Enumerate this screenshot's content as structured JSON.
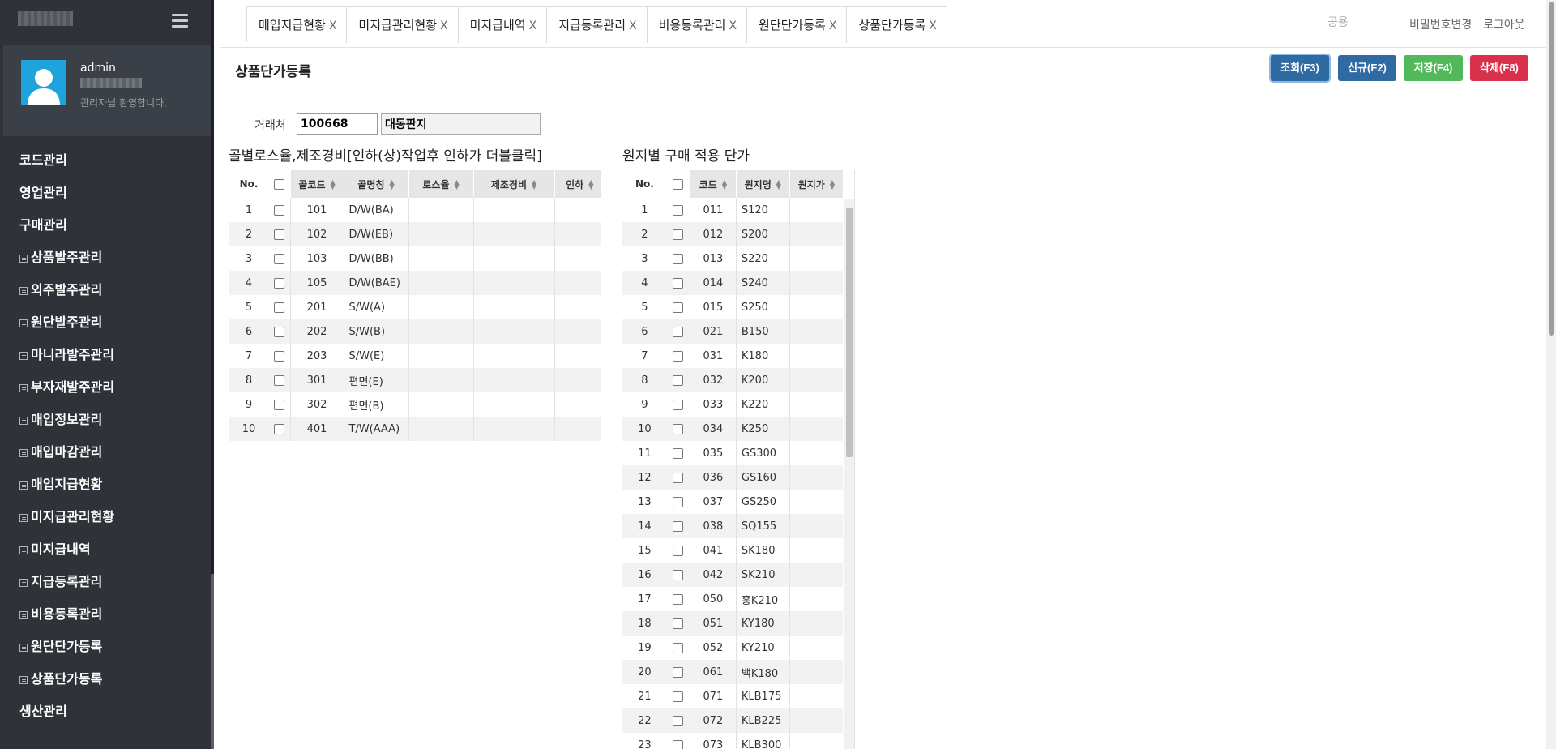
{
  "sidebar": {
    "user_name": "admin",
    "welcome": "관리자님 환영합니다.",
    "menu": [
      {
        "label": "코드관리",
        "sub": false
      },
      {
        "label": "영업관리",
        "sub": false
      },
      {
        "label": "구매관리",
        "sub": false
      },
      {
        "label": "상품발주관리",
        "sub": true
      },
      {
        "label": "외주발주관리",
        "sub": true
      },
      {
        "label": "원단발주관리",
        "sub": true
      },
      {
        "label": "마니라발주관리",
        "sub": true
      },
      {
        "label": "부자재발주관리",
        "sub": true
      },
      {
        "label": "매입정보관리",
        "sub": true
      },
      {
        "label": "매입마감관리",
        "sub": true
      },
      {
        "label": "매입지급현황",
        "sub": true
      },
      {
        "label": "미지급관리현황",
        "sub": true
      },
      {
        "label": "미지급내역",
        "sub": true
      },
      {
        "label": "지급등록관리",
        "sub": true
      },
      {
        "label": "비용등록관리",
        "sub": true
      },
      {
        "label": "원단단가등록",
        "sub": true
      },
      {
        "label": "상품단가등록",
        "sub": true
      },
      {
        "label": "생산관리",
        "sub": false
      }
    ]
  },
  "tabs": [
    {
      "label": "매입지급현황",
      "close": "X"
    },
    {
      "label": "미지급관리현황",
      "close": "X"
    },
    {
      "label": "미지급내역",
      "close": "X"
    },
    {
      "label": "지급등록관리",
      "close": "X"
    },
    {
      "label": "비용등록관리",
      "close": "X"
    },
    {
      "label": "원단단가등록",
      "close": "X"
    },
    {
      "label": "상품단가등록",
      "close": "X"
    }
  ],
  "header": {
    "search_placeholder": "공용",
    "change_password": "비밀번호변경",
    "logout": "로그아웃"
  },
  "page": {
    "title": "상품단가등록",
    "buttons": {
      "search": "조회(F3)",
      "new": "신규(F2)",
      "save": "저장(F4)",
      "delete": "삭제(F8)"
    },
    "vendor_label": "거래처",
    "vendor_code": "100668",
    "vendor_name": "대동판지"
  },
  "left_grid": {
    "title": "골별로스율,제조경비[인하(상)작업후 인하가 더블클릭]",
    "headers": [
      "No.",
      "",
      "골코드",
      "골명칭",
      "로스율",
      "제조경비",
      "인하"
    ],
    "rows": [
      [
        "1",
        "101",
        "D/W(BA)"
      ],
      [
        "2",
        "102",
        "D/W(EB)"
      ],
      [
        "3",
        "103",
        "D/W(BB)"
      ],
      [
        "4",
        "105",
        "D/W(BAE)"
      ],
      [
        "5",
        "201",
        "S/W(A)"
      ],
      [
        "6",
        "202",
        "S/W(B)"
      ],
      [
        "7",
        "203",
        "S/W(E)"
      ],
      [
        "8",
        "301",
        "편면(E)"
      ],
      [
        "9",
        "302",
        "편면(B)"
      ],
      [
        "10",
        "401",
        "T/W(AAA)"
      ]
    ]
  },
  "right_grid": {
    "title": "원지별 구매 적용 단가",
    "headers": [
      "No.",
      "",
      "코드",
      "원지명",
      "원지가"
    ],
    "rows": [
      [
        "1",
        "011",
        "S120"
      ],
      [
        "2",
        "012",
        "S200"
      ],
      [
        "3",
        "013",
        "S220"
      ],
      [
        "4",
        "014",
        "S240"
      ],
      [
        "5",
        "015",
        "S250"
      ],
      [
        "6",
        "021",
        "B150"
      ],
      [
        "7",
        "031",
        "K180"
      ],
      [
        "8",
        "032",
        "K200"
      ],
      [
        "9",
        "033",
        "K220"
      ],
      [
        "10",
        "034",
        "K250"
      ],
      [
        "11",
        "035",
        "GS300"
      ],
      [
        "12",
        "036",
        "GS160"
      ],
      [
        "13",
        "037",
        "GS250"
      ],
      [
        "14",
        "038",
        "SQ155"
      ],
      [
        "15",
        "041",
        "SK180"
      ],
      [
        "16",
        "042",
        "SK210"
      ],
      [
        "17",
        "050",
        "홍K210"
      ],
      [
        "18",
        "051",
        "KY180"
      ],
      [
        "19",
        "052",
        "KY210"
      ],
      [
        "20",
        "061",
        "백K180"
      ],
      [
        "21",
        "071",
        "KLB175"
      ],
      [
        "22",
        "072",
        "KLB225"
      ],
      [
        "23",
        "073",
        "KLB300"
      ]
    ]
  }
}
